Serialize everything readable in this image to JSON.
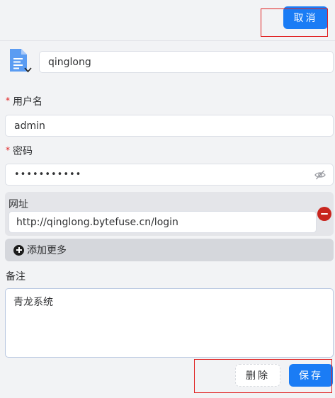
{
  "toolbar": {
    "cancel_label": "取消"
  },
  "entry": {
    "title_value": "qinglong",
    "icon": "document-icon"
  },
  "fields": {
    "username": {
      "label": "用户名",
      "required_mark": "*",
      "value": "admin"
    },
    "password": {
      "label": "密码",
      "required_mark": "*",
      "value": "•••••••••••",
      "visibility_icon": "eye-slash-icon"
    }
  },
  "url_section": {
    "label": "网址",
    "value": "http://qinglong.bytefuse.cn/login",
    "remove_icon": "minus-circle-icon"
  },
  "add_more": {
    "label": "添加更多",
    "icon": "plus-circle-icon"
  },
  "notes": {
    "label": "备注",
    "value": "青龙系统"
  },
  "footer": {
    "delete_label": "删除",
    "save_label": "保存"
  },
  "colors": {
    "primary": "#1a7cf5",
    "danger": "#c8251e",
    "highlight_box": "#e02020"
  }
}
